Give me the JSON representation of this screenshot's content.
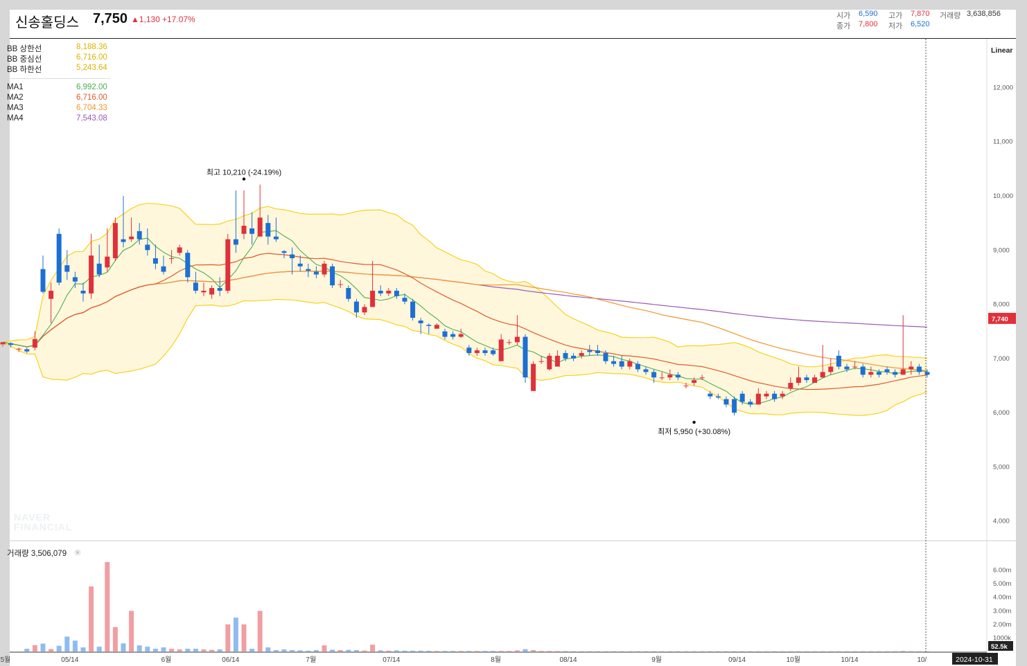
{
  "header": {
    "name": "신송홀딩스",
    "price": "7,750",
    "change": "▲1,130",
    "change_rate": "+17.07%",
    "open_label": "시가",
    "open": "6,590",
    "high_label": "고가",
    "high": "7,870",
    "volume_label": "거래량",
    "volume": "3,638,856",
    "close_label": "종가",
    "close": "7,800",
    "low_label": "저가",
    "low": "6,520"
  },
  "legend": {
    "bb_upper_label": "BB 상한선",
    "bb_upper": "8,188.36",
    "bb_mid_label": "BB 중심선",
    "bb_mid": "6,716.00",
    "bb_lower_label": "BB 하한선",
    "bb_lower": "5,243.64",
    "ma1_label": "MA1",
    "ma1": "6,992.00",
    "ma2_label": "MA2",
    "ma2": "6,716.00",
    "ma3_label": "MA3",
    "ma3": "6,704.33",
    "ma4_label": "MA4",
    "ma4": "7,543.08"
  },
  "scale_mode": "Linear",
  "volume_panel": {
    "label": "거래량 3,506,079",
    "close_icon": "close-icon"
  },
  "watermark": [
    "NAVER",
    "FINANCIAL"
  ],
  "colors": {
    "up": "#e0303a",
    "down": "#1c6fd4",
    "bb": "#f5d21b",
    "bb_fill": "#fff7dc",
    "ma1": "#4caf50",
    "ma2": "#e05a2a",
    "ma3": "#f0962c",
    "ma4": "#9b59b6"
  },
  "chart_data": {
    "type": "candlestick",
    "price_axis": {
      "ticks": [
        4000,
        5000,
        6000,
        7000,
        8000,
        9000,
        10000,
        11000,
        12000
      ],
      "tick_labels": [
        "4,000",
        "5,000",
        "6,000",
        "7,000",
        "8,000",
        "9,000",
        "10,000",
        "11,000",
        "12,000"
      ],
      "current_label": "7,740",
      "current": 7740,
      "ylim": [
        3650,
        12900
      ]
    },
    "volume_axis": {
      "ticks": [
        1000000,
        2000000,
        3000000,
        4000000,
        5000000,
        6000000
      ],
      "tick_labels": [
        "1000k",
        "2.00m",
        "3.00m",
        "4.00m",
        "5.00m",
        "6.00m"
      ],
      "current_label": "52.5k",
      "ylim": [
        0,
        6900000
      ]
    },
    "x_labels": [
      {
        "i": 0,
        "label": "5월"
      },
      {
        "i": 8,
        "label": "05/14"
      },
      {
        "i": 20,
        "label": "6월"
      },
      {
        "i": 28,
        "label": "06/14"
      },
      {
        "i": 38,
        "label": "7월"
      },
      {
        "i": 48,
        "label": "07/14"
      },
      {
        "i": 61,
        "label": "8월"
      },
      {
        "i": 70,
        "label": "08/14"
      },
      {
        "i": 81,
        "label": "9월"
      },
      {
        "i": 91,
        "label": "09/14"
      },
      {
        "i": 98,
        "label": "10월"
      },
      {
        "i": 105,
        "label": "10/14"
      },
      {
        "i": 114,
        "label": "10/"
      }
    ],
    "cursor_date": "2024-10-31",
    "annotations": [
      {
        "i": 30,
        "value": 10210,
        "text": "최고 10,210 (-24.19%)"
      },
      {
        "i": 86,
        "value": 5950,
        "text": "최저 5,950 (+30.08%)"
      }
    ],
    "candles": [
      [
        7260,
        7300,
        7250,
        7220,
        0
      ],
      [
        7280,
        7250,
        7300,
        7200,
        0
      ],
      [
        7180,
        7180,
        7200,
        7120,
        0
      ],
      [
        7170,
        7130,
        7200,
        7100,
        200000
      ],
      [
        7200,
        7360,
        7500,
        7150,
        460000
      ],
      [
        8650,
        8230,
        8900,
        8200,
        580000
      ],
      [
        8100,
        8250,
        8400,
        7650,
        180000
      ],
      [
        9300,
        8400,
        9400,
        8350,
        420000
      ],
      [
        8720,
        8600,
        9000,
        8450,
        1100000
      ],
      [
        8500,
        8420,
        8600,
        8300,
        800000
      ],
      [
        8250,
        8200,
        8400,
        8050,
        300000
      ],
      [
        8200,
        8900,
        9300,
        8100,
        4800000
      ],
      [
        8750,
        8550,
        9100,
        8500,
        350000
      ],
      [
        8680,
        8880,
        9400,
        8600,
        6600000
      ],
      [
        8850,
        9500,
        9600,
        8800,
        1800000
      ],
      [
        9200,
        9150,
        10000,
        9050,
        600000
      ],
      [
        9200,
        9250,
        9600,
        9150,
        3000000
      ],
      [
        9350,
        9200,
        9500,
        9100,
        450000
      ],
      [
        9100,
        9000,
        9400,
        8900,
        350000
      ],
      [
        8850,
        8750,
        9100,
        8650,
        200000
      ],
      [
        8700,
        8600,
        8900,
        8550,
        300000
      ],
      [
        8850,
        8850,
        9000,
        8750,
        200000
      ],
      [
        8950,
        9050,
        9100,
        8900,
        150000
      ],
      [
        8950,
        8500,
        9000,
        8400,
        200000
      ],
      [
        8400,
        8250,
        8600,
        8200,
        200000
      ],
      [
        8220,
        8250,
        8400,
        8150,
        150000
      ],
      [
        8180,
        8300,
        8350,
        8100,
        120000
      ],
      [
        8300,
        8250,
        8500,
        8150,
        150000
      ],
      [
        8250,
        9200,
        9300,
        8200,
        2000000
      ],
      [
        9200,
        9100,
        10100,
        8950,
        2500000
      ],
      [
        9300,
        9450,
        10100,
        9200,
        2000000
      ],
      [
        9400,
        9300,
        9700,
        9100,
        200000
      ],
      [
        9250,
        9600,
        10210,
        9250,
        3000000
      ],
      [
        9500,
        9250,
        9650,
        9100,
        300000
      ],
      [
        9250,
        9200,
        9600,
        9150,
        100000
      ],
      [
        8980,
        8950,
        9000,
        8850,
        150000
      ],
      [
        8920,
        8850,
        9050,
        8550,
        100000
      ],
      [
        8750,
        8700,
        8900,
        8600,
        80000
      ],
      [
        8650,
        8620,
        8750,
        8500,
        60000
      ],
      [
        8600,
        8550,
        8700,
        8480,
        100000
      ],
      [
        8550,
        8750,
        8800,
        8500,
        450000
      ],
      [
        8700,
        8350,
        8750,
        8300,
        130000
      ],
      [
        8370,
        8370,
        8450,
        8300,
        100000
      ],
      [
        8300,
        8100,
        8350,
        8050,
        120000
      ],
      [
        8050,
        7850,
        8100,
        7750,
        100000
      ],
      [
        7850,
        7950,
        8000,
        7800,
        70000
      ],
      [
        7950,
        8250,
        8800,
        7950,
        500000
      ],
      [
        8250,
        8200,
        8350,
        8150,
        80000
      ],
      [
        8200,
        8250,
        8300,
        8150,
        60000
      ],
      [
        8250,
        8150,
        8300,
        8100,
        80000
      ],
      [
        8120,
        8050,
        8200,
        8000,
        60000
      ],
      [
        8050,
        7750,
        8100,
        7700,
        60000
      ],
      [
        7700,
        7650,
        7750,
        7450,
        60000
      ],
      [
        7620,
        7600,
        7650,
        7450,
        50000
      ],
      [
        7550,
        7620,
        7650,
        7550,
        40000
      ],
      [
        7500,
        7400,
        7550,
        7350,
        40000
      ],
      [
        7450,
        7400,
        7500,
        7350,
        40000
      ],
      [
        7400,
        7450,
        7550,
        7380,
        40000
      ],
      [
        7200,
        7100,
        7250,
        7050,
        40000
      ],
      [
        7100,
        7150,
        7200,
        7050,
        40000
      ],
      [
        7150,
        7100,
        7200,
        7050,
        40000
      ],
      [
        7150,
        7080,
        7200,
        7050,
        40000
      ],
      [
        6950,
        7350,
        7450,
        6950,
        40000
      ],
      [
        7300,
        7300,
        7350,
        7250,
        40000
      ],
      [
        7300,
        7400,
        7800,
        7250,
        80000
      ],
      [
        7400,
        6650,
        7450,
        6550,
        170000
      ],
      [
        6400,
        6900,
        6950,
        6400,
        100000
      ],
      [
        6950,
        6950,
        7050,
        6900,
        40000
      ],
      [
        6800,
        7050,
        7100,
        6780,
        40000
      ],
      [
        6850,
        7050,
        7150,
        6850,
        30000
      ],
      [
        7100,
        7000,
        7150,
        6950,
        30000
      ],
      [
        7050,
        7000,
        7100,
        6950,
        20000
      ],
      [
        7050,
        7100,
        7150,
        7000,
        20000
      ],
      [
        7150,
        7120,
        7250,
        7050,
        20000
      ],
      [
        7150,
        7100,
        7250,
        7050,
        20000
      ],
      [
        7100,
        6950,
        7150,
        6900,
        20000
      ],
      [
        6950,
        6900,
        7050,
        6850,
        20000
      ],
      [
        6950,
        6850,
        7050,
        6800,
        20000
      ],
      [
        6850,
        6950,
        7000,
        6800,
        20000
      ],
      [
        6900,
        6800,
        6950,
        6750,
        20000
      ],
      [
        6800,
        6750,
        6850,
        6700,
        20000
      ],
      [
        6750,
        6650,
        6800,
        6550,
        20000
      ],
      [
        6650,
        6650,
        6750,
        6600,
        20000
      ],
      [
        6650,
        6700,
        6800,
        6600,
        20000
      ],
      [
        6700,
        6650,
        6750,
        6600,
        20000
      ],
      [
        6500,
        6500,
        6550,
        6450,
        20000
      ],
      [
        6550,
        6600,
        6650,
        6500,
        20000
      ],
      [
        6650,
        6650,
        6700,
        6600,
        20000
      ],
      [
        6350,
        6300,
        6400,
        6250,
        20000
      ],
      [
        6300,
        6280,
        6350,
        6250,
        20000
      ],
      [
        6250,
        6150,
        6300,
        6100,
        20000
      ],
      [
        6250,
        6000,
        6300,
        5950,
        20000
      ],
      [
        6350,
        6200,
        6400,
        6150,
        20000
      ],
      [
        6200,
        6150,
        6250,
        6100,
        20000
      ],
      [
        6150,
        6350,
        6450,
        6150,
        20000
      ],
      [
        6300,
        6350,
        6400,
        6250,
        20000
      ],
      [
        6350,
        6250,
        6400,
        6200,
        20000
      ],
      [
        6300,
        6350,
        6400,
        6250,
        20000
      ],
      [
        6450,
        6550,
        6650,
        6400,
        20000
      ],
      [
        6550,
        6650,
        6850,
        6500,
        20000
      ],
      [
        6650,
        6600,
        6700,
        6550,
        20000
      ],
      [
        6550,
        6650,
        6700,
        6550,
        20000
      ],
      [
        6650,
        6750,
        7250,
        6650,
        20000
      ],
      [
        6750,
        6850,
        7000,
        6700,
        20000
      ],
      [
        7050,
        6850,
        7150,
        6800,
        20000
      ],
      [
        6850,
        6800,
        6900,
        6750,
        20000
      ],
      [
        6850,
        6850,
        6950,
        6800,
        20000
      ],
      [
        6850,
        6700,
        6900,
        6650,
        20000
      ],
      [
        6700,
        6750,
        6850,
        6650,
        20000
      ],
      [
        6750,
        6700,
        6800,
        6650,
        20000
      ],
      [
        6800,
        6750,
        6850,
        6700,
        20000
      ],
      [
        6750,
        6700,
        6800,
        6650,
        20000
      ],
      [
        6700,
        6800,
        7800,
        6700,
        40000
      ],
      [
        6800,
        6850,
        6950,
        6700,
        20000
      ],
      [
        6850,
        6750,
        6900,
        6700,
        20000
      ],
      [
        6750,
        6700,
        6800,
        6650,
        20000
      ]
    ]
  }
}
